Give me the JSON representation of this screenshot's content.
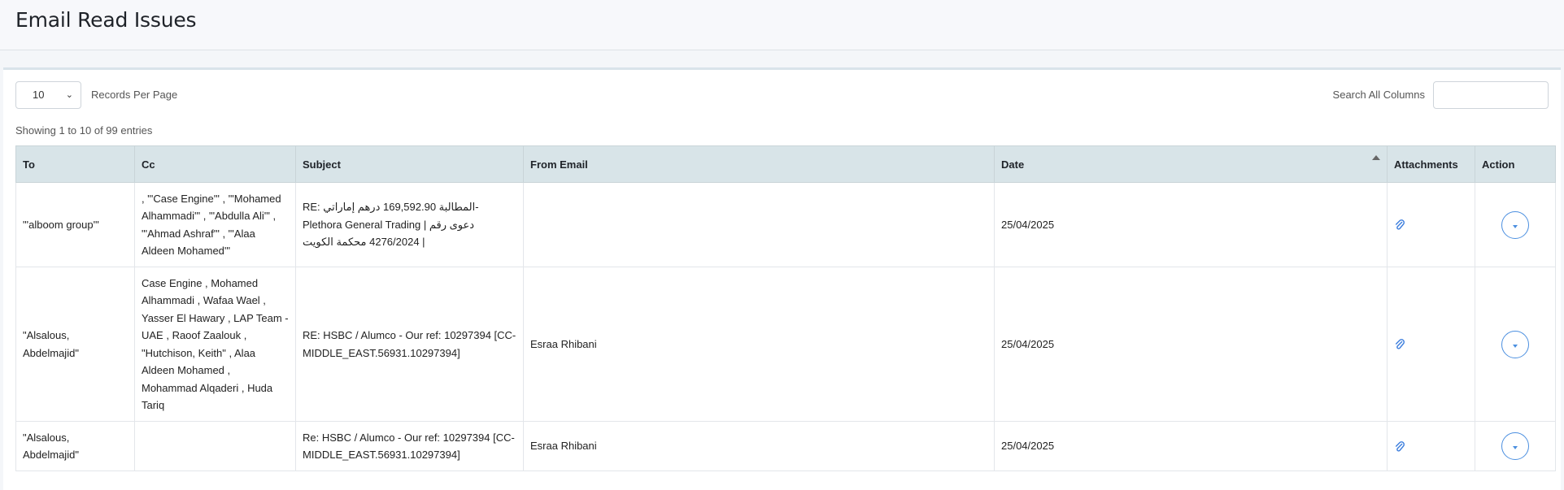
{
  "page": {
    "title": "Email Read Issues"
  },
  "controls": {
    "page_size": "10",
    "records_per_page_label": "Records Per Page",
    "search_label": "Search All Columns",
    "search_value": ""
  },
  "entries_info": "Showing 1 to 10 of 99 entries",
  "table": {
    "columns": [
      "To",
      "Cc",
      "Subject",
      "From Email",
      "Date",
      "Attachments",
      "Action"
    ],
    "sorted_column": "Date",
    "sort_direction": "asc",
    "rows": [
      {
        "to": "\"'alboom group'\"",
        "cc": ", \"'Case Engine'\" , \"'Mohamed Alhammadi'\" , \"'Abdulla Ali'\" , \"'Ahmad Ashraf'\" , \"'Alaa Aldeen Mohamed'\"",
        "subject": "RE: المطالبة 169,592.90 درهم إماراتي-Plethora General Trading | دعوى رقم 4276/2024 محكمة الكويت |",
        "from_email": "",
        "date": "25/04/2025",
        "has_attachment": true
      },
      {
        "to": "\"Alsalous, Abdelmajid\"",
        "cc": "Case Engine , Mohamed Alhammadi , Wafaa Wael , Yasser El Hawary , LAP Team - UAE , Raoof Zaalouk , \"Hutchison, Keith\" , Alaa Aldeen Mohamed , Mohammad Alqaderi , Huda Tariq",
        "subject": "RE: HSBC / Alumco - Our ref: 10297394 [CC-MIDDLE_EAST.56931.10297394]",
        "from_email": "Esraa Rhibani",
        "date": "25/04/2025",
        "has_attachment": true
      },
      {
        "to": "\"Alsalous, Abdelmajid\"",
        "cc": "",
        "subject": "Re: HSBC / Alumco - Our ref: 10297394 [CC-MIDDLE_EAST.56931.10297394]",
        "from_email": "Esraa Rhibani",
        "date": "25/04/2025",
        "has_attachment": true
      }
    ]
  },
  "colors": {
    "header_bg": "#d8e4e8",
    "accent": "#4b8fe0",
    "page_bg": "#f4f6f9"
  },
  "icons": {
    "attachment": "paperclip-icon",
    "action": "chevron-down-circle-icon",
    "sort": "sort-asc-icon"
  }
}
